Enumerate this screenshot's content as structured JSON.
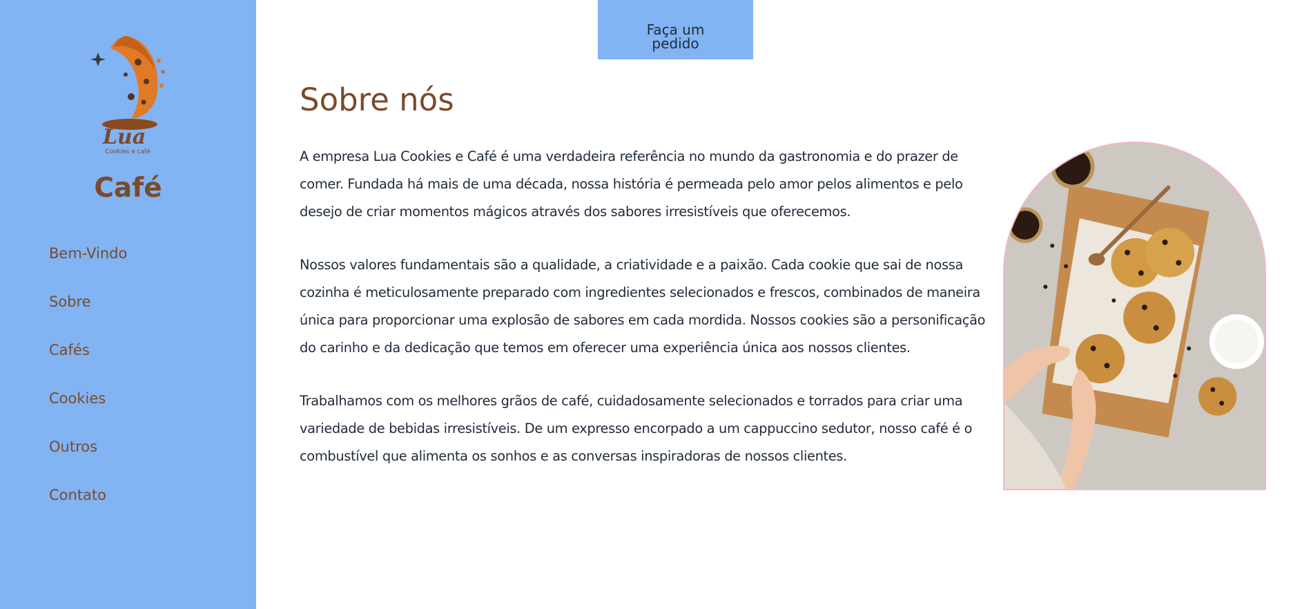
{
  "sidebar": {
    "logo_text": "Lua",
    "logo_subtext": "Cookies e café",
    "title": "Café",
    "nav": [
      "Bem-Vindo",
      "Sobre",
      "Cafés",
      "Cookies",
      "Outros",
      "Contato"
    ]
  },
  "header": {
    "order_button": "Faça um pedido"
  },
  "main": {
    "title": "Sobre nós",
    "paragraphs": [
      "A empresa Lua Cookies e Café é uma verdadeira referência no mundo da gastronomia e do prazer de comer. Fundada há mais de uma década, nossa história é permeada pelo amor pelos alimentos e pelo desejo de criar momentos mágicos através dos sabores irresistíveis que oferecemos.",
      "Nossos valores fundamentais são a qualidade, a criatividade e a paixão. Cada cookie que sai de nossa cozinha é meticulosamente preparado com ingredientes selecionados e frescos, combinados de maneira única para proporcionar uma explosão de sabores em cada mordida. Nossos cookies são a personificação do carinho e da dedicação que temos em oferecer uma experiência única aos nossos clientes.",
      "Trabalhamos com os melhores grãos de café, cuidadosamente selecionados e torrados para criar uma variedade de bebidas irresistíveis. De um expresso encorpado a um cappuccino sedutor, nosso café é o combustível que alimenta os sonhos e as conversas inspiradoras de nossos clientes."
    ]
  },
  "colors": {
    "sidebar_bg": "#82b3f2",
    "brand_brown": "#7a4a2c",
    "text_dark": "#1f2a3a",
    "photo_border": "#f4b6c8"
  },
  "icons": {
    "logo": "cookie-moon-logo-icon",
    "photo": "cookies-photo"
  }
}
